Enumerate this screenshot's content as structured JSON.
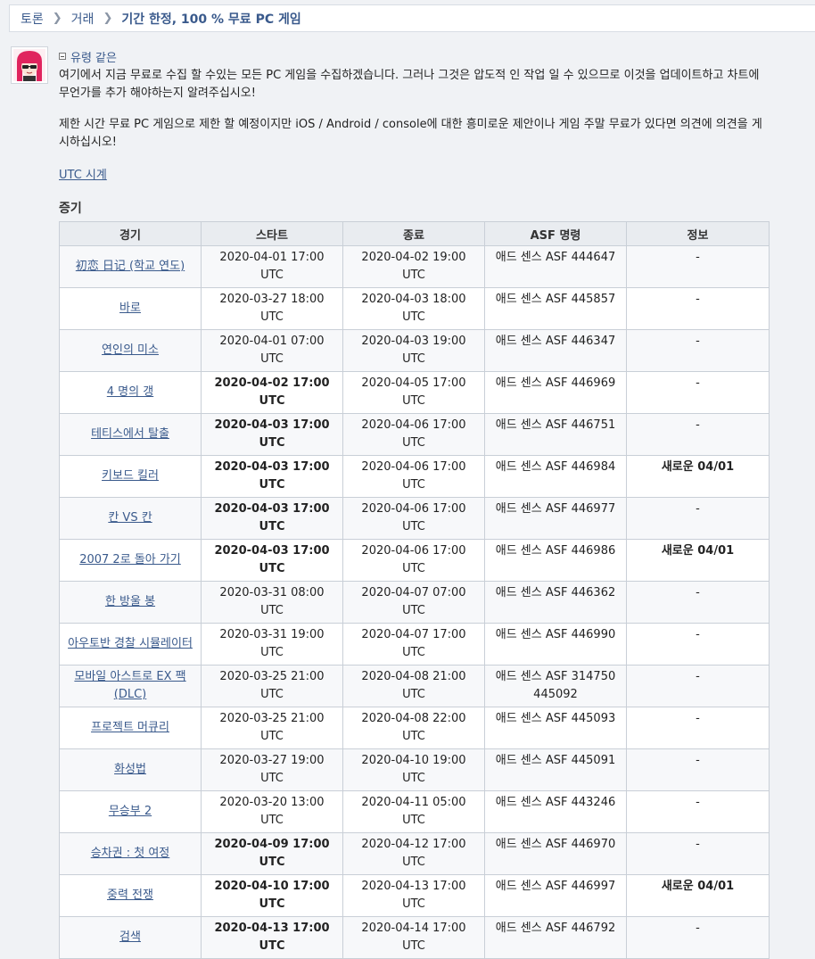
{
  "breadcrumb": [
    "토론",
    "거래",
    "기간 한정, 100 % 무료 PC 게임"
  ],
  "post": {
    "author": "유령 같은",
    "paragraph1": "여기에서 지금 무료로 수집 할 수있는 모든 PC 게임을 수집하겠습니다. 그러나 그것은 압도적 인 작업 일 수 있으므로 이것을 업데이트하고 차트에 무언가를 추가 해야하는지 알려주십시오!",
    "paragraph2": "제한 시간 무료 PC 게임으로 제한 할 예정이지만 iOS / Android / console에 대한 흥미로운 제안이나 게임 주말 무료가 있다면 의견에 의견을 게시하십시오!",
    "utc_link": "UTC 시계",
    "section_title": "증기"
  },
  "table": {
    "headers": [
      "경기",
      "스타트",
      "종료",
      "ASF 명령",
      "정보"
    ],
    "rows": [
      {
        "game": "初恋 日记 (학교 연도)",
        "start": "2020-04-01 17:00 UTC",
        "end": "2020-04-02 19:00 UTC",
        "asf": "애드 센스 ASF 444647",
        "info": "-",
        "bold_start": false
      },
      {
        "game": "바로",
        "start": "2020-03-27 18:00 UTC",
        "end": "2020-04-03 18:00 UTC",
        "asf": "애드 센스 ASF 445857",
        "info": "-",
        "bold_start": false
      },
      {
        "game": "연인의 미소",
        "start": "2020-04-01 07:00 UTC",
        "end": "2020-04-03 19:00 UTC",
        "asf": "애드 센스 ASF 446347",
        "info": "-",
        "bold_start": false
      },
      {
        "game": "4 명의 갱",
        "start": "2020-04-02 17:00 UTC",
        "end": "2020-04-05 17:00 UTC",
        "asf": "애드 센스 ASF 446969",
        "info": "-",
        "bold_start": true
      },
      {
        "game": "테티스에서 탈출",
        "start": "2020-04-03 17:00 UTC",
        "end": "2020-04-06 17:00 UTC",
        "asf": "애드 센스 ASF 446751",
        "info": "-",
        "bold_start": true
      },
      {
        "game": "키보드 킬러",
        "start": "2020-04-03 17:00 UTC",
        "end": "2020-04-06 17:00 UTC",
        "asf": "애드 센스 ASF 446984",
        "info": "새로운 04/01",
        "bold_start": true
      },
      {
        "game": "칸 VS 칸",
        "start": "2020-04-03 17:00 UTC",
        "end": "2020-04-06 17:00 UTC",
        "asf": "애드 센스 ASF 446977",
        "info": "-",
        "bold_start": true
      },
      {
        "game": "2007 2로 돌아 가기",
        "start": "2020-04-03 17:00 UTC",
        "end": "2020-04-06 17:00 UTC",
        "asf": "애드 센스 ASF 446986",
        "info": "새로운 04/01",
        "bold_start": true
      },
      {
        "game": "한 방울 봉",
        "start": "2020-03-31 08:00 UTC",
        "end": "2020-04-07 07:00 UTC",
        "asf": "애드 센스 ASF 446362",
        "info": "-",
        "bold_start": false
      },
      {
        "game": "아우토반 경찰 시뮬레이터",
        "start": "2020-03-31 19:00 UTC",
        "end": "2020-04-07 17:00 UTC",
        "asf": "애드 센스 ASF 446990",
        "info": "-",
        "bold_start": false
      },
      {
        "game": "모바일 아스트로 EX 팩 (DLC)",
        "start": "2020-03-25 21:00 UTC",
        "end": "2020-04-08 21:00 UTC",
        "asf": "애드 센스 ASF 314750 445092",
        "info": "-",
        "bold_start": false
      },
      {
        "game": "프로젝트 머큐리",
        "start": "2020-03-25 21:00 UTC",
        "end": "2020-04-08 22:00 UTC",
        "asf": "애드 센스 ASF 445093",
        "info": "-",
        "bold_start": false
      },
      {
        "game": "화성법",
        "start": "2020-03-27 19:00 UTC",
        "end": "2020-04-10 19:00 UTC",
        "asf": "애드 센스 ASF 445091",
        "info": "-",
        "bold_start": false
      },
      {
        "game": "무승부 2",
        "start": "2020-03-20 13:00 UTC",
        "end": "2020-04-11 05:00 UTC",
        "asf": "애드 센스 ASF 443246",
        "info": "-",
        "bold_start": false
      },
      {
        "game": "승차권 : 첫 여정",
        "start": "2020-04-09 17:00 UTC",
        "end": "2020-04-12 17:00 UTC",
        "asf": "애드 센스 ASF 446970",
        "info": "-",
        "bold_start": true
      },
      {
        "game": "중력 전쟁",
        "start": "2020-04-10 17:00 UTC",
        "end": "2020-04-13 17:00 UTC",
        "asf": "애드 센스 ASF 446997",
        "info": "새로운 04/01",
        "bold_start": true
      },
      {
        "game": "검색",
        "start": "2020-04-13 17:00 UTC",
        "end": "2020-04-14 17:00 UTC",
        "asf": "애드 센스 ASF 446792",
        "info": "-",
        "bold_start": true
      }
    ]
  },
  "icons": {
    "collapse": "collapse-minus-icon",
    "avatar": "user-avatar-image"
  },
  "colors": {
    "link": "#3a5a8c",
    "header_bg": "#e9ecf0",
    "border": "#c9cfd7",
    "page_bg": "#f0f2f5"
  }
}
